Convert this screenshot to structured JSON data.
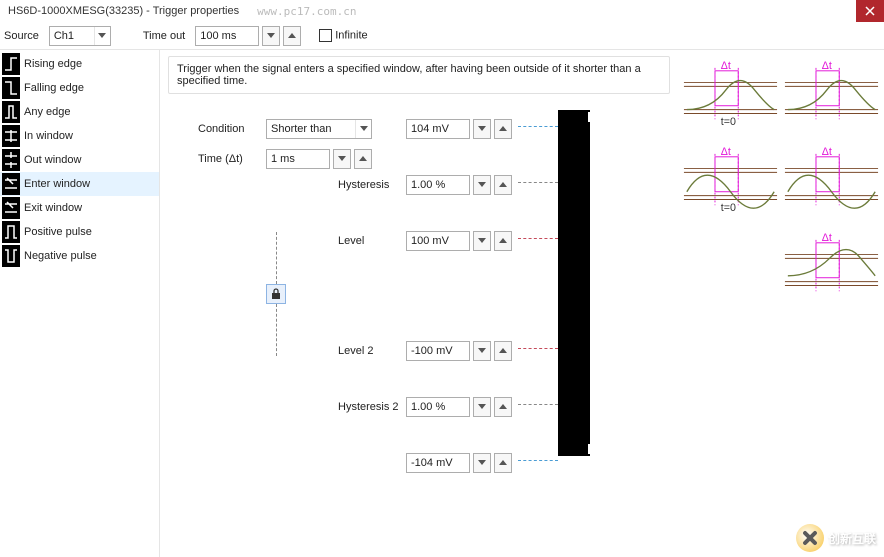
{
  "title": "HS6D-1000XMESG(33235) - Trigger properties",
  "watermark": "www.pc17.com.cn",
  "toolbar": {
    "source_label": "Source",
    "source_value": "Ch1",
    "timeout_label": "Time out",
    "timeout_value": "100 ms",
    "infinite_label": "Infinite",
    "infinite_checked": false
  },
  "kinds": [
    {
      "id": "rising-edge",
      "label": "Rising edge"
    },
    {
      "id": "falling-edge",
      "label": "Falling edge"
    },
    {
      "id": "any-edge",
      "label": "Any edge"
    },
    {
      "id": "in-window",
      "label": "In window"
    },
    {
      "id": "out-window",
      "label": "Out window"
    },
    {
      "id": "enter-window",
      "label": "Enter window"
    },
    {
      "id": "exit-window",
      "label": "Exit window"
    },
    {
      "id": "positive-pulse",
      "label": "Positive pulse"
    },
    {
      "id": "negative-pulse",
      "label": "Negative pulse"
    }
  ],
  "selected_kind": "enter-window",
  "description": "Trigger when the signal enters a specified window, after having been outside of it shorter than a specified time.",
  "params": {
    "upper_limit": {
      "value": "104 mV"
    },
    "hysteresis": {
      "label": "Hysteresis",
      "value": "1.00 %"
    },
    "level": {
      "label": "Level",
      "value": "100 mV"
    },
    "level2": {
      "label": "Level 2",
      "value": "-100 mV"
    },
    "hysteresis2": {
      "label": "Hysteresis 2",
      "value": "1.00 %"
    },
    "lower_limit": {
      "value": "-104 mV"
    }
  },
  "locked": true,
  "condition": {
    "label": "Condition",
    "value": "Shorter than",
    "time_label": "Time (Δt)",
    "time_value": "1 ms"
  },
  "footer_brand": "创新互联",
  "colors": {
    "blue_dash": "#4a9cd4",
    "red_dash": "#c44a5a",
    "gray_dash": "#888",
    "magenta": "#e216d8",
    "olive": "#6b7b3a",
    "brown": "#7a4a2a"
  },
  "thumbs": {
    "dt_label": "Δt",
    "t0_label": "t=0"
  }
}
